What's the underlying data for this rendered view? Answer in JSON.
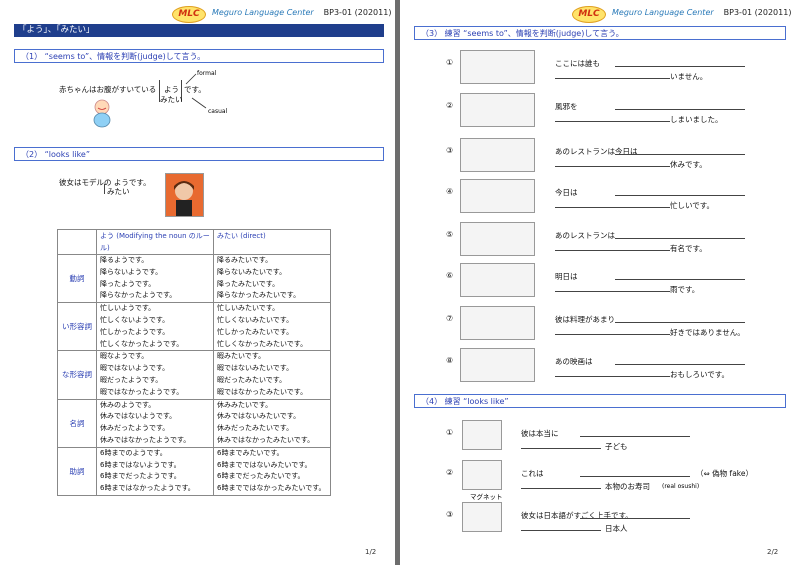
{
  "header": {
    "logo": "MLC",
    "center": "Meguro Language Center",
    "code": "BP3-01 (202011)"
  },
  "page1": {
    "title": "「よう」、「みたい」",
    "section1": "（1） “seems to”、情報を判断(judge)して言う。",
    "s1_sentence": "赤ちゃんはお腹がすいている",
    "s1_you": "よう",
    "s1_mitai": "みたい",
    "s1_desu": "です。",
    "s1_formal": "formal",
    "s1_casual": "casual",
    "section2": "（2） “looks like”",
    "s2_sentence": "彼女はモデルの ようです。",
    "s2_mitai": "みたい",
    "table": {
      "head_you": "よう (Modifying the noun のルール)",
      "head_mitai": "みたい (direct)",
      "rows": [
        {
          "cat": "動詞",
          "you": [
            "降るようです。",
            "降らないようです。",
            "降ったようです。",
            "降らなかったようです。"
          ],
          "mitai": [
            "降るみたいです。",
            "降らないみたいです。",
            "降ったみたいです。",
            "降らなかったみたいです。"
          ]
        },
        {
          "cat": "い形容詞",
          "you": [
            "忙しいようです。",
            "忙しくないようです。",
            "忙しかったようです。",
            "忙しくなかったようです。"
          ],
          "mitai": [
            "忙しいみたいです。",
            "忙しくないみたいです。",
            "忙しかったみたいです。",
            "忙しくなかったみたいです。"
          ]
        },
        {
          "cat": "な形容詞",
          "you": [
            "暇なようです。",
            "暇ではないようです。",
            "暇だったようです。",
            "暇ではなかったようです。"
          ],
          "mitai": [
            "暇みたいです。",
            "暇ではないみたいです。",
            "暇だったみたいです。",
            "暇ではなかったみたいです。"
          ]
        },
        {
          "cat": "名詞",
          "you": [
            "休みのようです。",
            "休みではないようです。",
            "休みだったようです。",
            "休みではなかったようです。"
          ],
          "mitai": [
            "休みみたいです。",
            "休みではないみたいです。",
            "休みだったみたいです。",
            "休みではなかったみたいです。"
          ]
        },
        {
          "cat": "助詞",
          "you": [
            "6時までのようです。",
            "6時まではないようです。",
            "6時までだったようです。",
            "6時まではなかったようです。"
          ],
          "mitai": [
            "6時までみたいです。",
            "6時までではないみたいです。",
            "6時までだったみたいです。",
            "6時までではなかったみたいです。"
          ]
        }
      ]
    },
    "page_num": "1/2"
  },
  "page2": {
    "section3": "（3） 練習 “seems to”、情報を判断(judge)して言う。",
    "ex3": [
      {
        "n": "①",
        "a": "ここには誰も",
        "b": "いません。"
      },
      {
        "n": "②",
        "a": "風邪を",
        "b": "しまいました。"
      },
      {
        "n": "③",
        "a": "あのレストランは今日は",
        "b": "休みです。"
      },
      {
        "n": "④",
        "a": "今日は",
        "b": "忙しいです。"
      },
      {
        "n": "⑤",
        "a": "あのレストランは",
        "b": "有名です。"
      },
      {
        "n": "⑥",
        "a": "明日は",
        "b": "雨です。"
      },
      {
        "n": "⑦",
        "a": "彼は料理があまり",
        "b": "好きではありません。"
      },
      {
        "n": "⑧",
        "a": "あの映画は",
        "b": "おもしろいです。"
      }
    ],
    "section4": "（4） 練習 “looks like”",
    "ex4": [
      {
        "n": "①",
        "a": "彼は本当に",
        "b": "子ども"
      },
      {
        "n": "②",
        "a": "これは",
        "arrow": "（⇔ 偽物 fake）",
        "b": "本物のお寿司",
        "b_note": "(real osushi)",
        "caption": "マグネット"
      },
      {
        "n": "③",
        "a": "彼女は日本語がすごく上手です。",
        "b": "日本人"
      }
    ],
    "page_num": "2/2"
  }
}
